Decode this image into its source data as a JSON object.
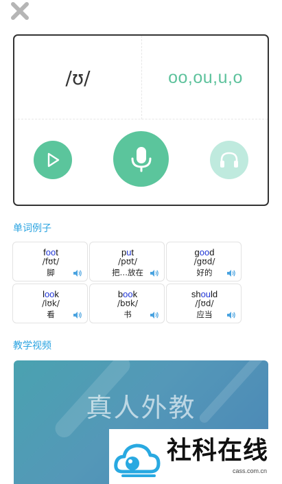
{
  "phoneme": {
    "ipa": "/ʊ/",
    "spellings": "oo,ou,u,o"
  },
  "sections": {
    "examples_title": "单词例子",
    "video_title": "教学视频"
  },
  "words": [
    {
      "pre": "f",
      "hl": "oo",
      "post": "t",
      "ipa": "/fʊt/",
      "meaning": "脚"
    },
    {
      "pre": "p",
      "hl": "u",
      "post": "t",
      "ipa": "/pʊt/",
      "meaning": "把…放在"
    },
    {
      "pre": "g",
      "hl": "oo",
      "post": "d",
      "ipa": "/gʊd/",
      "meaning": "好的"
    },
    {
      "pre": "l",
      "hl": "oo",
      "post": "k",
      "ipa": "/lʊk/",
      "meaning": "看"
    },
    {
      "pre": "b",
      "hl": "oo",
      "post": "k",
      "ipa": "/bʊk/",
      "meaning": "书"
    },
    {
      "pre": "sh",
      "hl": "ou",
      "post": "ld",
      "ipa": "/ʃʊd/",
      "meaning": "应当"
    }
  ],
  "video": {
    "title": "真人外教"
  },
  "watermark": {
    "name": "社科在线",
    "domain": "cass.com.cn"
  },
  "colors": {
    "accent_green": "#5bc59c",
    "light_green": "#bfeade",
    "section_blue": "#2aa3e0",
    "highlight_blue": "#1f35d6"
  },
  "icons": [
    "close-icon",
    "play-icon",
    "microphone-icon",
    "headphones-icon",
    "speaker-icon"
  ]
}
